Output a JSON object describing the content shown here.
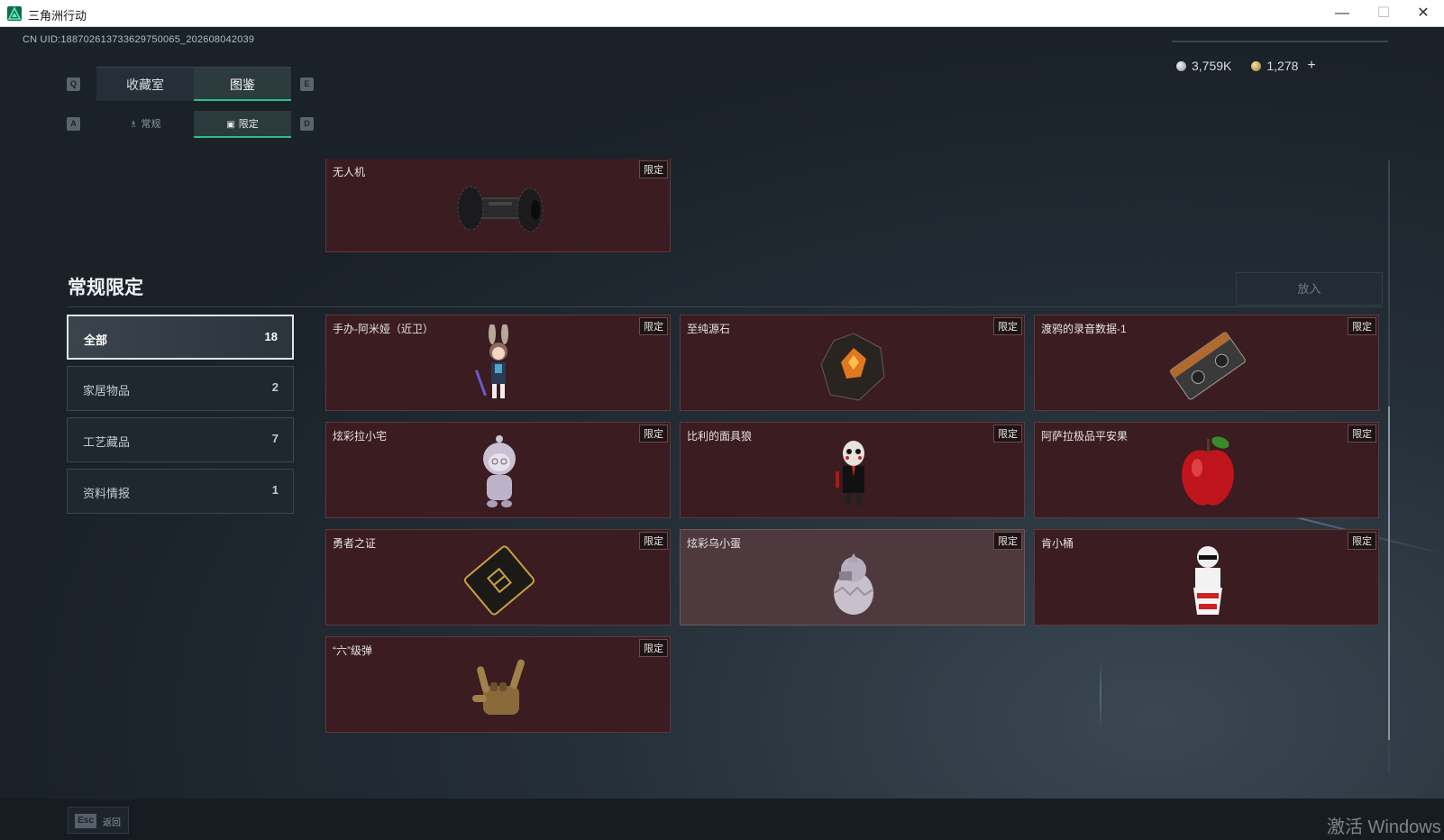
{
  "window": {
    "title": "三角洲行动",
    "min": "—",
    "max": "☐",
    "close": "✕"
  },
  "uid": "CN UID:1887026137336297500​65_202608042039",
  "currency": {
    "silver": "3,759K",
    "gold": "1,278",
    "plus": "+"
  },
  "keys": {
    "prev_tab": "Q",
    "next_tab": "E",
    "prev_sub": "A",
    "next_sub": "D"
  },
  "tabs": [
    {
      "label": "收藏室"
    },
    {
      "label": "图鉴"
    }
  ],
  "subtabs": [
    {
      "label": "常规"
    },
    {
      "label": "限定"
    }
  ],
  "top_card": {
    "name": "无人机",
    "badge": "限定"
  },
  "section": {
    "title": "常规限定",
    "place_button": "放入"
  },
  "categories": [
    {
      "label": "全部",
      "count": "18"
    },
    {
      "label": "家居物品",
      "count": "2"
    },
    {
      "label": "工艺藏品",
      "count": "7"
    },
    {
      "label": "资料情报",
      "count": "1"
    }
  ],
  "items": [
    {
      "name": "手办-阿米娅（近卫）",
      "badge": "限定",
      "icon": "figure-rabbit-girl-icon"
    },
    {
      "name": "至纯源石",
      "badge": "限定",
      "icon": "originium-crystal-icon"
    },
    {
      "name": "渡鸦的录音数据-1",
      "badge": "限定",
      "icon": "cassette-tape-icon"
    },
    {
      "name": "炫彩拉小宅",
      "badge": "限定",
      "icon": "hooded-figure-icon"
    },
    {
      "name": "比利的面具狼",
      "badge": "限定",
      "icon": "billy-puppet-icon"
    },
    {
      "name": "阿萨拉极品平安果",
      "badge": "限定",
      "icon": "red-apple-icon"
    },
    {
      "name": "勇者之证",
      "badge": "限定",
      "icon": "gold-card-icon"
    },
    {
      "name": "炫彩乌小蛋",
      "badge": "限定",
      "icon": "egg-bird-icon"
    },
    {
      "name": "肯小桶",
      "badge": "限定",
      "icon": "colonel-bucket-icon"
    },
    {
      "name": "“六”级弹",
      "badge": "限定",
      "icon": "rock-hand-icon"
    }
  ],
  "footer": {
    "esc_key": "Esc",
    "back_label": "返回"
  },
  "watermark": "激活 Windows"
}
